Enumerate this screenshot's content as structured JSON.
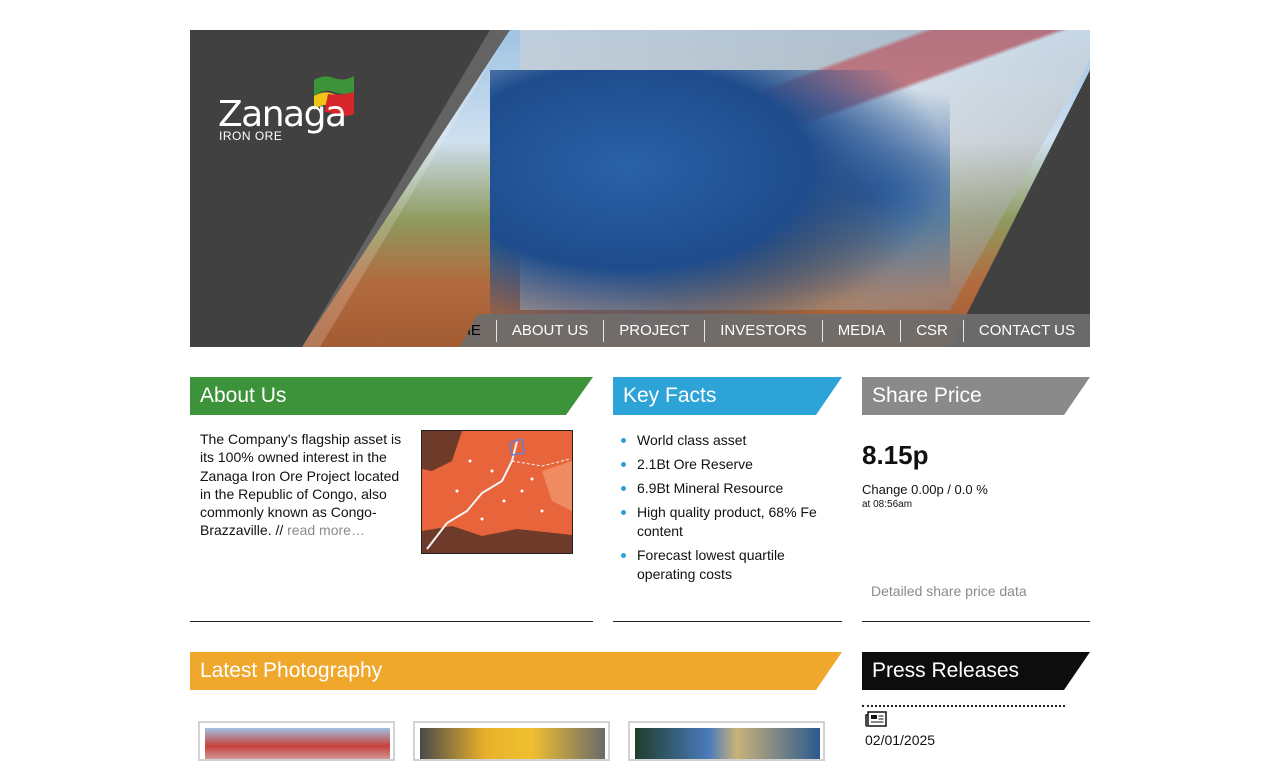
{
  "header": {
    "logo_word": "Zanaga",
    "logo_sub": "IRON ORE"
  },
  "nav": {
    "items": [
      {
        "label": "HOME",
        "active": true
      },
      {
        "label": "ABOUT US"
      },
      {
        "label": "PROJECT"
      },
      {
        "label": "INVESTORS"
      },
      {
        "label": "MEDIA"
      },
      {
        "label": "CSR"
      },
      {
        "label": "CONTACT US"
      }
    ]
  },
  "about": {
    "title": "About Us",
    "text": "The Company's flagship asset is its 100% owned interest in the Zanaga Iron Ore Project located in the Republic of Congo, also commonly known as Congo-Brazzaville. // ",
    "read_more": "read more…"
  },
  "facts": {
    "title": "Key Facts",
    "items": [
      "World class asset",
      "2.1Bt Ore Reserve",
      "6.9Bt Mineral Resource",
      "High quality product, 68% Fe content",
      "Forecast lowest quartile operating costs"
    ]
  },
  "share": {
    "title": "Share Price",
    "price": "8.15p",
    "change": "Change 0.00p / 0.0 %",
    "time": "at 08:56am",
    "details_link": "Detailed share price data"
  },
  "photography": {
    "title": "Latest Photography"
  },
  "press": {
    "title": "Press Releases",
    "date": "02/01/2025"
  },
  "colors": {
    "about": "#3c9339",
    "facts": "#2da3d7",
    "share": "#8a8a8a",
    "photography": "#f0a82c",
    "press": "#0d0d0d"
  }
}
